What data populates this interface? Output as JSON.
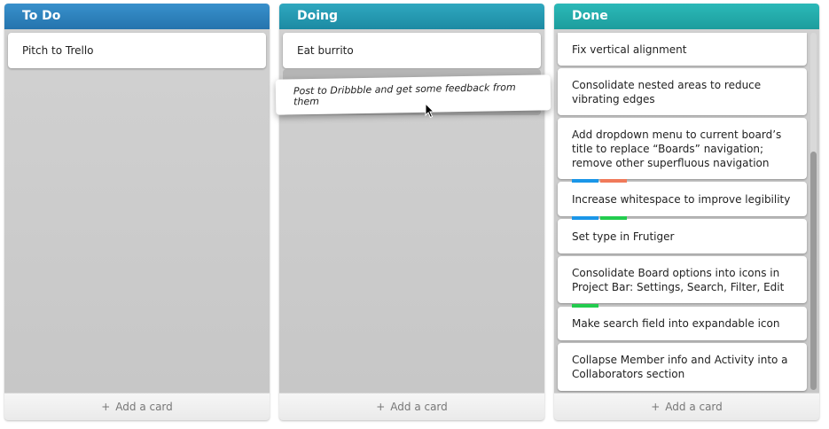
{
  "lists": [
    {
      "title": "To Do",
      "color": "#2a81bd",
      "cards": [
        {
          "text": "Pitch to Trello"
        }
      ],
      "add_card": "Add a card"
    },
    {
      "title": "Doing",
      "color": "#2399b0",
      "cards": [
        {
          "text": "Eat burrito"
        }
      ],
      "dragging_card": {
        "text": "Post to Dribbble and get some feedback from them"
      },
      "add_card": "Add a card"
    },
    {
      "title": "Done",
      "color": "#23aaaa",
      "cards": [
        {
          "text": "Fix vertical alignment"
        },
        {
          "text": "Consolidate nested areas to reduce vibrating edges"
        },
        {
          "text": "Add dropdown menu to current board’s title to replace “Boards” navigation; remove other superfluous navigation"
        },
        {
          "text": "Increase whitespace to improve legibility",
          "labels": [
            "#1a96e8",
            "#f07a5a"
          ]
        },
        {
          "text": "Set type in Frutiger",
          "labels": [
            "#1a96e8",
            "#22cc4e"
          ]
        },
        {
          "text": "Consolidate Board options into icons in Project Bar: Settings, Search, Filter, Edit"
        },
        {
          "text": "Make search field into expandable icon",
          "labels": [
            "#22cc4e"
          ]
        },
        {
          "text": "Collapse Member info and Activity into a Collaborators section"
        }
      ],
      "add_card": "Add a card"
    }
  ],
  "icons": {
    "add": "plus-icon",
    "cursor": "arrow-cursor-icon"
  }
}
